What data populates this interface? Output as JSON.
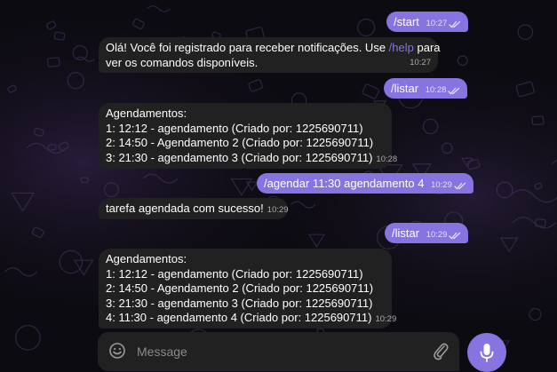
{
  "colors": {
    "outgoing": "#8774e1",
    "incoming": "#212121",
    "background": "#0d0b12",
    "link": "#8774e1"
  },
  "messages": [
    {
      "dir": "out",
      "text": "/start",
      "time": "10:27",
      "read": true
    },
    {
      "dir": "in",
      "text_before_link": "Olá! Você foi registrado para receber notificações. Use ",
      "link": "/help",
      "text_after_link": " para",
      "line2": "ver os comandos disponíveis.",
      "time": "10:27"
    },
    {
      "dir": "out",
      "text": "/listar",
      "time": "10:28",
      "read": true
    },
    {
      "dir": "in",
      "lines": [
        "Agendamentos:",
        "1: 12:12 - agendamento (Criado por: 1225690711)",
        "2: 14:50 - Agendamento 2 (Criado por: 1225690711)",
        "3: 21:30 - agendamento 3 (Criado por: 1225690711)"
      ],
      "time": "10:28"
    },
    {
      "dir": "out",
      "text": "/agendar 11:30 agendamento 4",
      "time": "10:29",
      "read": true
    },
    {
      "dir": "in",
      "text": "tarefa agendada com sucesso!",
      "time": "10:29"
    },
    {
      "dir": "out",
      "text": "/listar",
      "time": "10:29",
      "read": true
    },
    {
      "dir": "in",
      "lines": [
        "Agendamentos:",
        "1: 12:12 - agendamento (Criado por: 1225690711)",
        "2: 14:50 - Agendamento 2 (Criado por: 1225690711)",
        "3: 21:30 - agendamento 3 (Criado por: 1225690711)",
        "4: 11:30 - agendamento 4 (Criado por: 1225690711)"
      ],
      "time": "10:29"
    }
  ],
  "composer": {
    "placeholder": "Message",
    "emoji_icon": "smile-icon",
    "attach_icon": "paperclip-icon",
    "send_icon": "microphone-icon"
  }
}
